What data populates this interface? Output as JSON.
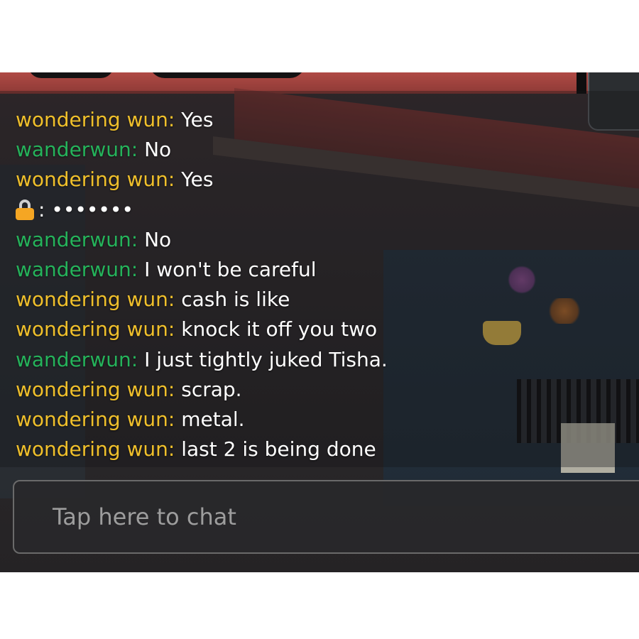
{
  "colors": {
    "name_yellow": "#f0c02b",
    "name_green": "#25b35b",
    "message_text": "#ffffff",
    "placeholder_text": "#9d9d9d"
  },
  "chat": {
    "messages": [
      {
        "name": "wondering wun",
        "text": "Yes",
        "color": "yellow"
      },
      {
        "name": "wanderwun",
        "text": "No",
        "color": "green"
      },
      {
        "name": "wondering wun",
        "text": "Yes",
        "color": "yellow"
      },
      {
        "icon": "lock-icon",
        "text": "•••••••"
      },
      {
        "name": "wanderwun",
        "text": "No",
        "color": "green"
      },
      {
        "name": "wanderwun",
        "text": "I won't be careful",
        "color": "green"
      },
      {
        "name": "wondering wun",
        "text": "cash is like",
        "color": "yellow"
      },
      {
        "name": "wondering wun",
        "text": "knock it off you two",
        "color": "yellow"
      },
      {
        "name": "wanderwun",
        "text": "I just tightly juked Tisha.",
        "color": "green"
      },
      {
        "name": "wondering wun",
        "text": "scrap.",
        "color": "yellow"
      },
      {
        "name": "wondering wun",
        "text": "metal.",
        "color": "yellow"
      },
      {
        "name": "wondering wun",
        "text": "last 2 is being done",
        "color": "yellow"
      }
    ],
    "separator": ":",
    "input": {
      "placeholder": "Tap here to chat"
    }
  }
}
